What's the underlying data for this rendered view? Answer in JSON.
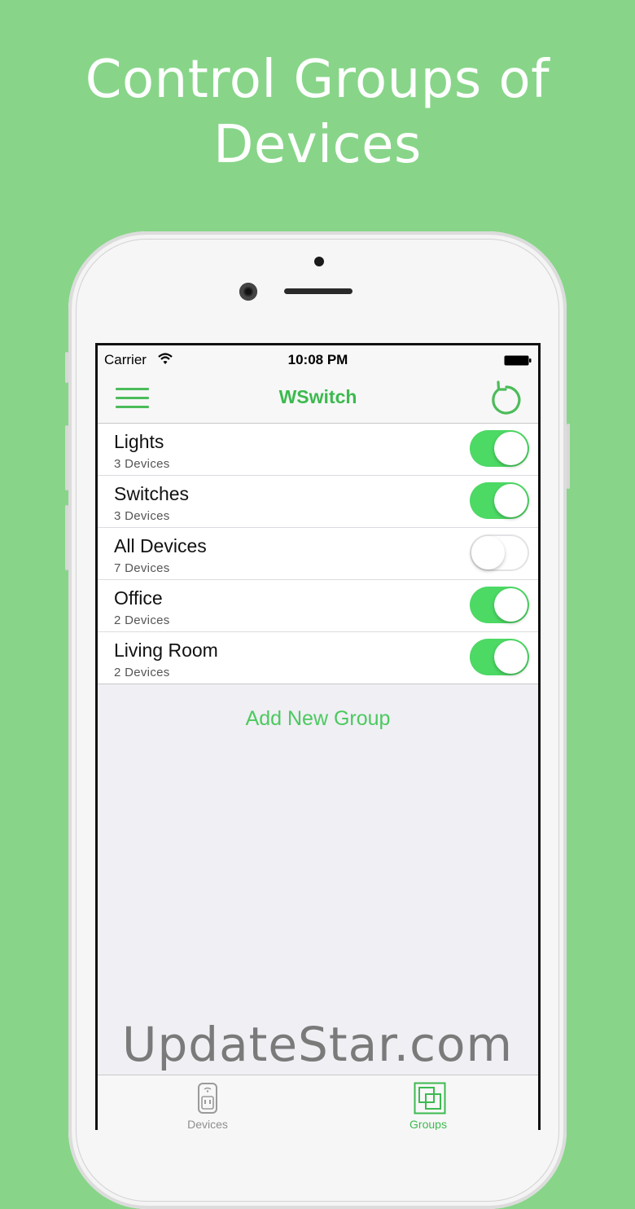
{
  "headline": {
    "line1": "Control Groups of",
    "line2": "Devices"
  },
  "status_bar": {
    "carrier": "Carrier",
    "time": "10:08 PM"
  },
  "nav": {
    "title": "WSwitch",
    "menu_icon": "hamburger-icon",
    "refresh_icon": "refresh-icon"
  },
  "groups": [
    {
      "name": "Lights",
      "count": "3 Devices",
      "on": true
    },
    {
      "name": "Switches",
      "count": "3 Devices",
      "on": true
    },
    {
      "name": "All Devices",
      "count": "7 Devices",
      "on": false
    },
    {
      "name": "Office",
      "count": "2 Devices",
      "on": true
    },
    {
      "name": "Living Room",
      "count": "2 Devices",
      "on": true
    }
  ],
  "add_group_label": "Add New Group",
  "tabs": [
    {
      "label": "Devices",
      "icon": "plug-device-icon",
      "active": false
    },
    {
      "label": "Groups",
      "icon": "groups-icon",
      "active": true
    }
  ],
  "watermark": "UpdateStar.com",
  "colors": {
    "background": "#88d589",
    "accent": "#3cba4f",
    "toggle_on": "#4cd964"
  }
}
